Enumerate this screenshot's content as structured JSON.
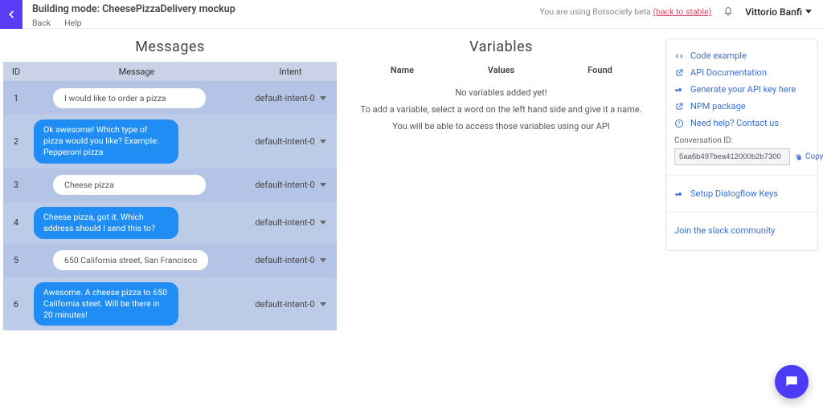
{
  "header": {
    "title": "Building mode: CheesePizzaDelivery mockup",
    "back": "Back",
    "help": "Help",
    "beta_text": "You are using Botsociety beta ",
    "beta_link": "(back to stable)",
    "user": "Vittorio Banfi"
  },
  "messages": {
    "title": "Messages",
    "columns": {
      "id": "ID",
      "message": "Message",
      "intent": "Intent"
    },
    "default_intent": "default-intent-0",
    "rows": [
      {
        "id": "1",
        "type": "user",
        "text": "I would like to order a pizza"
      },
      {
        "id": "2",
        "type": "bot",
        "text": "Ok awesome! Which type of pizza would you like? Example: Pepperoni pizza"
      },
      {
        "id": "3",
        "type": "user",
        "text": "Cheese pizza"
      },
      {
        "id": "4",
        "type": "bot",
        "text": "Cheese pizza, got it. Which address should I send this to?"
      },
      {
        "id": "5",
        "type": "user",
        "text": "650 California street, San Francisco"
      },
      {
        "id": "6",
        "type": "bot",
        "text": "Awesome. A cheese pizza to 650 California steet. Will be there in 20 minutes!"
      }
    ]
  },
  "variables": {
    "title": "Variables",
    "columns": {
      "name": "Name",
      "values": "Values",
      "found": "Found"
    },
    "empty1": "No variables added yet!",
    "empty2": "To add a variable, select a word on the left hand side and give it a name.",
    "empty3": "You will be able to access those variables using our API"
  },
  "side": {
    "links": {
      "code": "Code example",
      "api": "API Documentation",
      "key": "Generate your API key here",
      "npm": "NPM package",
      "help": "Need help? Contact us"
    },
    "conv_label": "Conversation ID:",
    "conv_id": "5aa6b497bea412000b2b7300",
    "copy": "Copy",
    "dialogflow": "Setup Dialogflow Keys",
    "slack": "Join the slack community"
  }
}
